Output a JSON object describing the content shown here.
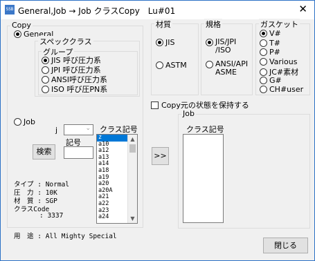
{
  "window": {
    "title": "General,Job → Job クラスCopy　Lu#01",
    "icon_text": "SSB",
    "close": "✕"
  },
  "copy_group": {
    "legend": "Copy",
    "general_label": "General",
    "spec_class_legend": "スペッククラス",
    "group_legend": "グループ",
    "group_options": [
      "JIS 呼び圧力系",
      "JPI 呼び圧力系",
      "ANSI呼び圧力系",
      "ISO 呼び圧PN系"
    ],
    "job_label": "Job",
    "j_label": "j",
    "number_label": "記号",
    "search_button": "検索",
    "class_label": "クラス記号",
    "class_list": [
      "z",
      "a10",
      "a12",
      "a13",
      "a14",
      "a18",
      "a19",
      "a20",
      "a20A",
      "a21",
      "a22",
      "a23",
      "a24"
    ],
    "info": {
      "type_label": "タイプ",
      "type_value": ": Normal",
      "pressure_label": "圧　力",
      "pressure_value": ": 10K",
      "material_label": "材　質",
      "material_value": ": SGP",
      "code_label": "クラスCode",
      "code_value": ": 3337"
    }
  },
  "usage": {
    "label": "用　途",
    "value": ": All Mighty Special"
  },
  "material_group": {
    "legend": "材質",
    "options": [
      "JIS",
      "ASTM"
    ]
  },
  "standard_group": {
    "legend": "規格",
    "options": [
      "JIS/JPI\n/ISO",
      "ANSI/API\nASME"
    ]
  },
  "gasket_group": {
    "legend": "ガスケット",
    "options": [
      "V#",
      "T#",
      "P#",
      "Various",
      "JC#素材",
      "G#",
      "CH#user"
    ]
  },
  "keep_state_label": "Copy元の状態を保持する",
  "transfer_button": ">>",
  "job_group": {
    "legend": "Job",
    "class_label": "クラス記号"
  },
  "close_button": "閉じる"
}
